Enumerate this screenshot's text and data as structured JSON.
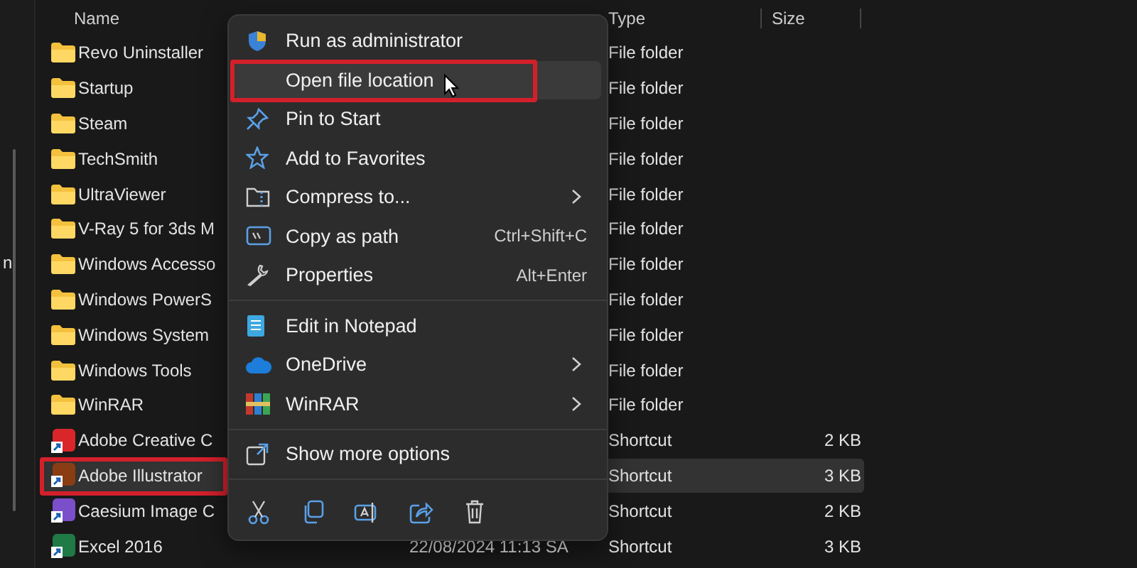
{
  "nav_pane": {
    "text": "n"
  },
  "file_list": {
    "columns": [
      {
        "label": "Name"
      },
      {
        "label": "Type"
      },
      {
        "label": "Size"
      }
    ],
    "rows": [
      {
        "kind": "folder",
        "name": "Revo Uninstaller",
        "type": "File folder",
        "selected": false,
        "highlighted": false
      },
      {
        "kind": "folder",
        "name": "Startup",
        "type": "File folder",
        "selected": false,
        "highlighted": false
      },
      {
        "kind": "folder",
        "name": "Steam",
        "type": "File folder",
        "selected": false,
        "highlighted": false
      },
      {
        "kind": "folder",
        "name": "TechSmith",
        "type": "File folder",
        "selected": false,
        "highlighted": false
      },
      {
        "kind": "folder",
        "name": "UltraViewer",
        "type": "File folder",
        "selected": false,
        "highlighted": false
      },
      {
        "kind": "folder",
        "name": "V-Ray 5 for 3ds M",
        "type": "File folder",
        "selected": false,
        "highlighted": false
      },
      {
        "kind": "folder",
        "name": "Windows Accesso",
        "type": "File folder",
        "selected": false,
        "highlighted": false
      },
      {
        "kind": "folder",
        "name": "Windows PowerS",
        "type": "File folder",
        "selected": false,
        "highlighted": false
      },
      {
        "kind": "folder",
        "name": "Windows System",
        "type": "File folder",
        "selected": false,
        "highlighted": false
      },
      {
        "kind": "folder",
        "name": "Windows Tools",
        "type": "File folder",
        "selected": false,
        "highlighted": false
      },
      {
        "kind": "folder",
        "name": "WinRAR",
        "type": "File folder",
        "selected": false,
        "highlighted": false
      },
      {
        "kind": "shortcut",
        "color": "#d9262b",
        "name": "Adobe Creative C",
        "type": "Shortcut",
        "size": "2 KB",
        "selected": false,
        "highlighted": false
      },
      {
        "kind": "shortcut",
        "color": "#8a3d12",
        "name": "Adobe Illustrator",
        "type": "Shortcut",
        "size": "3 KB",
        "selected": true,
        "highlighted": true
      },
      {
        "kind": "shortcut",
        "color": "#7b4fc9",
        "name": "Caesium Image C",
        "type": "Shortcut",
        "size": "2 KB",
        "selected": false,
        "highlighted": false
      },
      {
        "kind": "shortcut",
        "color": "#1f7a45",
        "name": "Excel 2016",
        "date": "22/08/2024 11:13 SA",
        "type": "Shortcut",
        "size": "3 KB",
        "selected": false,
        "highlighted": false
      }
    ]
  },
  "context_menu": {
    "items": [
      {
        "kind": "item",
        "label": "Run as administrator",
        "hovered": false,
        "highlighted": false
      },
      {
        "kind": "item",
        "label": "Open file location",
        "hovered": true,
        "highlighted": true
      },
      {
        "kind": "item",
        "label": "Pin to Start",
        "hovered": false,
        "highlighted": false
      },
      {
        "kind": "item",
        "label": "Add to Favorites",
        "hovered": false,
        "highlighted": false
      },
      {
        "kind": "submenu",
        "label": "Compress to...",
        "hovered": false,
        "highlighted": false
      },
      {
        "kind": "item",
        "label": "Copy as path",
        "shortcut": "Ctrl+Shift+C",
        "hovered": false,
        "highlighted": false
      },
      {
        "kind": "item",
        "label": "Properties",
        "shortcut": "Alt+Enter",
        "hovered": false,
        "highlighted": false
      },
      {
        "kind": "separator"
      },
      {
        "kind": "item",
        "label": "Edit in Notepad",
        "hovered": false,
        "highlighted": false
      },
      {
        "kind": "submenu",
        "label": "OneDrive",
        "hovered": false,
        "highlighted": false
      },
      {
        "kind": "submenu",
        "label": "WinRAR",
        "hovered": false,
        "highlighted": false
      },
      {
        "kind": "separator"
      },
      {
        "kind": "item",
        "label": "Show more options",
        "hovered": false,
        "highlighted": false
      },
      {
        "kind": "separator"
      }
    ]
  }
}
